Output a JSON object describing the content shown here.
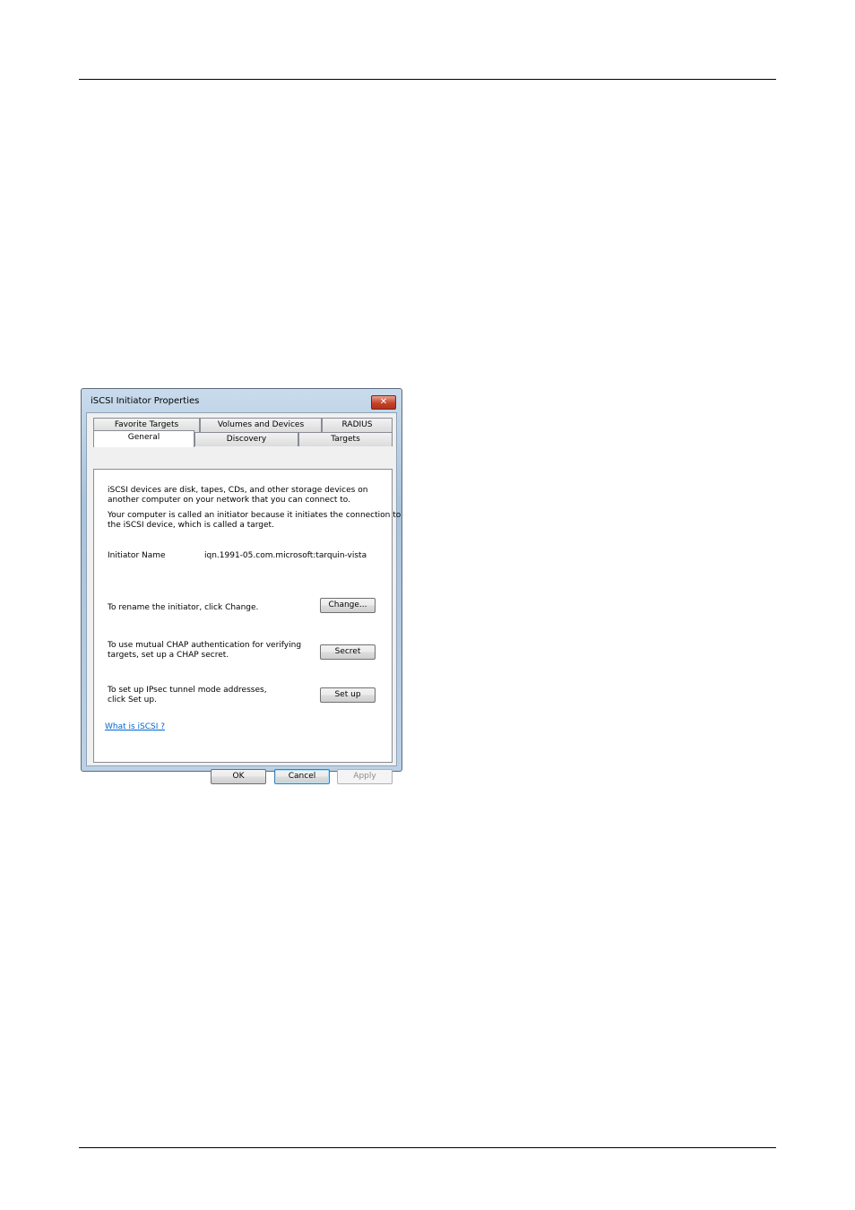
{
  "window": {
    "title": "iSCSI Initiator Properties",
    "close_label": "✕"
  },
  "tabs": {
    "row1": [
      "Favorite Targets",
      "Volumes and Devices",
      "RADIUS"
    ],
    "row2": [
      "General",
      "Discovery",
      "Targets"
    ],
    "active": "General"
  },
  "general": {
    "intro_line1": "iSCSI devices are disk, tapes, CDs, and other storage devices on",
    "intro_line2": "another computer on your network that you can connect to.",
    "desc_line1": "Your computer is called an initiator because it initiates the connection to",
    "desc_line2": "the iSCSI device, which is called a target.",
    "initiator_name_label": "Initiator Name",
    "initiator_name_value": "iqn.1991-05.com.microsoft:tarquin-vista",
    "rename_text": "To rename the initiator, click Change.",
    "change_button": "Change...",
    "chap_line1": "To use mutual CHAP authentication for verifying",
    "chap_line2": "targets, set up a CHAP secret.",
    "secret_button": "Secret",
    "ipsec_line1": "To set up IPsec tunnel mode addresses,",
    "ipsec_line2": "click Set up.",
    "setup_button": "Set up",
    "help_link": "What is iSCSI ?"
  },
  "footer": {
    "ok_button": "OK",
    "cancel_button": "Cancel",
    "apply_button": "Apply"
  }
}
